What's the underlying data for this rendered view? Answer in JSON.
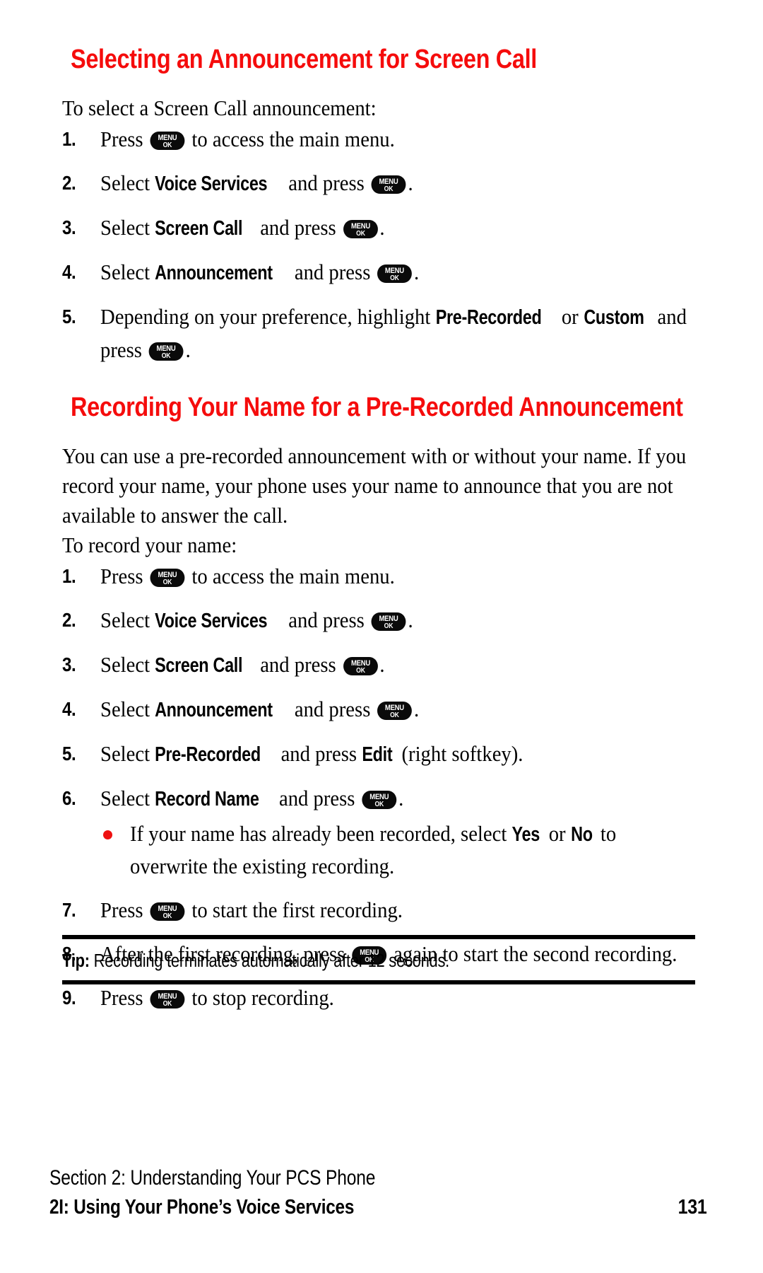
{
  "colors": {
    "heading_red": "#F50C0C",
    "bullet_red": "#EE1111",
    "text_black": "#000000",
    "key_black": "#0A0A0A",
    "page_background": "#FFFFFF"
  },
  "keycap": {
    "line1": "MENU",
    "line2": "OK",
    "icon_name": "menu-ok-key-icon"
  },
  "section_1": {
    "heading": "Selecting an Announcement for Screen Call",
    "intro": "To select a Screen Call announcement:",
    "steps": [
      {
        "num": "1.",
        "parts": [
          {
            "type": "text",
            "value": "Press "
          },
          {
            "type": "key"
          },
          {
            "type": "text",
            "value": " to access the main menu."
          }
        ]
      },
      {
        "num": "2.",
        "parts": [
          {
            "type": "text",
            "value": "Select "
          },
          {
            "type": "menu",
            "value": "Voice Services"
          },
          {
            "type": "text",
            "value": " and press "
          },
          {
            "type": "key"
          },
          {
            "type": "text",
            "value": "."
          }
        ]
      },
      {
        "num": "3.",
        "parts": [
          {
            "type": "text",
            "value": "Select "
          },
          {
            "type": "menu",
            "value": "Screen Call"
          },
          {
            "type": "text",
            "value": " and press "
          },
          {
            "type": "key"
          },
          {
            "type": "text",
            "value": "."
          }
        ]
      },
      {
        "num": "4.",
        "parts": [
          {
            "type": "text",
            "value": "Select "
          },
          {
            "type": "menu",
            "value": "Announcement"
          },
          {
            "type": "text",
            "value": " and press "
          },
          {
            "type": "key"
          },
          {
            "type": "text",
            "value": "."
          }
        ]
      },
      {
        "num": "5.",
        "parts": [
          {
            "type": "text",
            "value": "Depending on your preference, highlight "
          },
          {
            "type": "menu",
            "value": "Pre-Recorded"
          },
          {
            "type": "text",
            "value": " or "
          },
          {
            "type": "menu",
            "value": "Custom"
          },
          {
            "type": "text",
            "value": " and press "
          },
          {
            "type": "key"
          },
          {
            "type": "text",
            "value": "."
          }
        ]
      }
    ]
  },
  "section_2": {
    "heading": "Recording Your Name for a Pre-Recorded Announcement",
    "paragraph": "You can use a pre-recorded announcement with or without your name. If you record your name, your phone uses your name to announce that you are not available to answer the call.",
    "intro": "To record your name:",
    "steps": [
      {
        "num": "1.",
        "parts": [
          {
            "type": "text",
            "value": "Press "
          },
          {
            "type": "key"
          },
          {
            "type": "text",
            "value": " to access the main menu."
          }
        ]
      },
      {
        "num": "2.",
        "parts": [
          {
            "type": "text",
            "value": "Select "
          },
          {
            "type": "menu",
            "value": "Voice Services"
          },
          {
            "type": "text",
            "value": " and press "
          },
          {
            "type": "key"
          },
          {
            "type": "text",
            "value": "."
          }
        ]
      },
      {
        "num": "3.",
        "parts": [
          {
            "type": "text",
            "value": "Select "
          },
          {
            "type": "menu",
            "value": "Screen Call"
          },
          {
            "type": "text",
            "value": " and press "
          },
          {
            "type": "key"
          },
          {
            "type": "text",
            "value": "."
          }
        ]
      },
      {
        "num": "4.",
        "parts": [
          {
            "type": "text",
            "value": "Select "
          },
          {
            "type": "menu",
            "value": "Announcement"
          },
          {
            "type": "text",
            "value": " and press "
          },
          {
            "type": "key"
          },
          {
            "type": "text",
            "value": "."
          }
        ]
      },
      {
        "num": "5.",
        "parts": [
          {
            "type": "text",
            "value": "Select "
          },
          {
            "type": "menu",
            "value": "Pre-Recorded"
          },
          {
            "type": "text",
            "value": " and press "
          },
          {
            "type": "menu",
            "value": "Edit"
          },
          {
            "type": "text",
            "value": " (right softkey)."
          }
        ]
      },
      {
        "num": "6.",
        "parts": [
          {
            "type": "text",
            "value": "Select "
          },
          {
            "type": "menu",
            "value": "Record Name"
          },
          {
            "type": "text",
            "value": " and press "
          },
          {
            "type": "key"
          },
          {
            "type": "text",
            "value": "."
          }
        ],
        "sub_bullets": [
          {
            "parts": [
              {
                "type": "text",
                "value": "If your name has already been recorded, select "
              },
              {
                "type": "menu",
                "value": "Yes"
              },
              {
                "type": "text",
                "value": " or "
              },
              {
                "type": "menu",
                "value": "No"
              },
              {
                "type": "text",
                "value": " to overwrite the existing recording."
              }
            ]
          }
        ]
      },
      {
        "num": "7.",
        "parts": [
          {
            "type": "text",
            "value": "Press "
          },
          {
            "type": "key"
          },
          {
            "type": "text",
            "value": " to start the first recording."
          }
        ]
      },
      {
        "num": "8.",
        "parts": [
          {
            "type": "text",
            "value": "After the first recording, press "
          },
          {
            "type": "key"
          },
          {
            "type": "text",
            "value": " again to start the second recording."
          }
        ]
      },
      {
        "num": "9.",
        "parts": [
          {
            "type": "text",
            "value": "Press "
          },
          {
            "type": "key"
          },
          {
            "type": "text",
            "value": " to stop recording."
          }
        ]
      }
    ]
  },
  "tip": {
    "label": "Tip:",
    "text": " Recording terminates automatically after 12 seconds."
  },
  "footer": {
    "section_line": "Section 2: Understanding Your PCS Phone",
    "chapter_line": "2I: Using Your Phone’s Voice Services",
    "page_number": "131"
  }
}
